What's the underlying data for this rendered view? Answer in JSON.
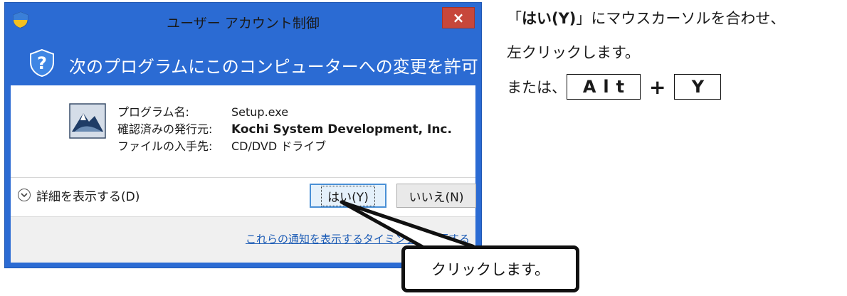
{
  "dialog": {
    "title": "ユーザー アカウント制御",
    "close_symbol": "×",
    "question": "次のプログラムにこのコンピューターへの変更を許可しますか?",
    "info": {
      "labels": [
        "プログラム名:",
        "確認済みの発行元:",
        "ファイルの入手先:"
      ],
      "program": "Setup.exe",
      "publisher": "Kochi System Development, Inc.",
      "source": "CD/DVD ドライブ"
    },
    "details_label": "詳細を表示する(D)",
    "yes_label": "はい(Y)",
    "no_label": "いいえ(N)",
    "footer_link": "これらの通知を表示するタイミングを変更する",
    "colors": {
      "header_blue": "#2b6bd3",
      "close_red": "#c7473b",
      "link": "#1b5bb5"
    }
  },
  "callout": {
    "text": "クリックします。"
  },
  "instructions": {
    "line1_open": "「",
    "line1_button": "はい(Y)",
    "line1_rest": "」にマウスカーソルを合わせ、",
    "line2": "左クリックします。",
    "line3_prefix": "または、",
    "key1": "Alt",
    "plus": "+",
    "key2": "Y"
  },
  "icons": [
    "shield-icon",
    "question-icon",
    "program-icon",
    "chevron-down-icon",
    "close-icon"
  ]
}
